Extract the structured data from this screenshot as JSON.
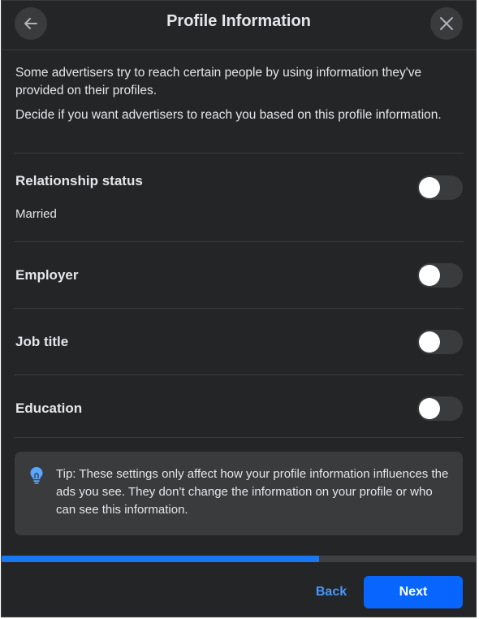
{
  "header": {
    "title": "Profile Information",
    "back_icon": "arrow-left-icon",
    "close_icon": "close-icon"
  },
  "intro": {
    "p1": "Some advertisers try to reach certain people by using information they've provided on their profiles.",
    "p2": "Decide if you want advertisers to reach you based on this profile information."
  },
  "settings": [
    {
      "label": "Relationship status",
      "value": "Married",
      "enabled": false
    },
    {
      "label": "Employer",
      "enabled": false
    },
    {
      "label": "Job title",
      "enabled": false
    },
    {
      "label": "Education",
      "enabled": false
    }
  ],
  "tip": {
    "icon": "lightbulb-icon",
    "text": "Tip: These settings only affect how your profile information influences the ads you see. They don't change the information on your profile or who can see this information."
  },
  "progress": {
    "fraction": 0.67
  },
  "footer": {
    "back_label": "Back",
    "next_label": "Next"
  },
  "colors": {
    "background": "#242526",
    "accent": "#0866ff",
    "link": "#4599ff"
  }
}
